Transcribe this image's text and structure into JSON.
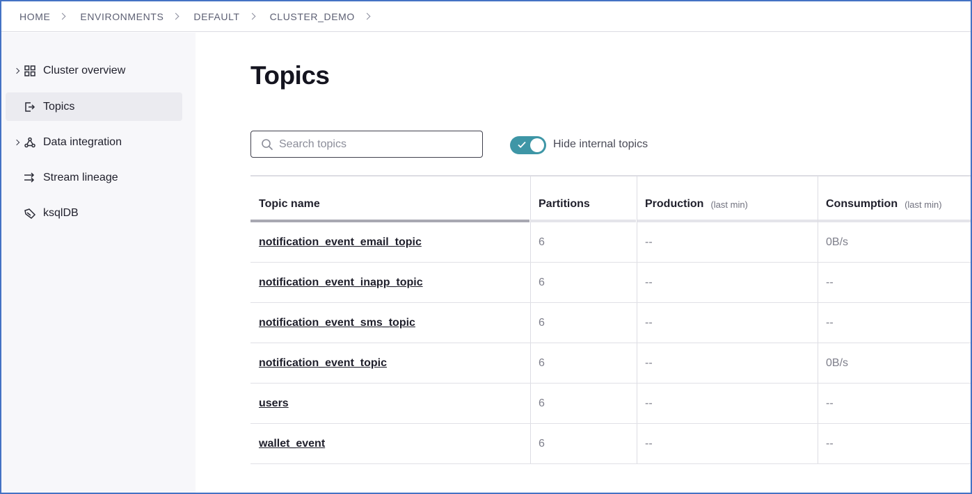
{
  "breadcrumb": [
    "HOME",
    "ENVIRONMENTS",
    "DEFAULT",
    "CLUSTER_DEMO"
  ],
  "sidebar": {
    "items": [
      {
        "label": "Cluster overview",
        "icon": "grid-icon",
        "expandable": true,
        "active": false
      },
      {
        "label": "Topics",
        "icon": "topics-icon",
        "expandable": false,
        "active": true
      },
      {
        "label": "Data integration",
        "icon": "integration-icon",
        "expandable": true,
        "active": false
      },
      {
        "label": "Stream lineage",
        "icon": "stream-lineage-icon",
        "expandable": false,
        "active": false
      },
      {
        "label": "ksqlDB",
        "icon": "ksqldb-icon",
        "expandable": false,
        "active": false
      }
    ]
  },
  "main": {
    "title": "Topics",
    "search": {
      "placeholder": "Search topics",
      "value": ""
    },
    "toggle": {
      "label": "Hide internal topics",
      "checked": true
    }
  },
  "table": {
    "columns": [
      {
        "title": "Topic name",
        "sub": ""
      },
      {
        "title": "Partitions",
        "sub": ""
      },
      {
        "title": "Production",
        "sub": "(last min)"
      },
      {
        "title": "Consumption",
        "sub": "(last min)"
      }
    ],
    "rows": [
      {
        "name": "notification_event_email_topic",
        "partitions": "6",
        "production": "--",
        "consumption": "0B/s"
      },
      {
        "name": "notification_event_inapp_topic",
        "partitions": "6",
        "production": "--",
        "consumption": "--"
      },
      {
        "name": "notification_event_sms_topic",
        "partitions": "6",
        "production": "--",
        "consumption": "--"
      },
      {
        "name": "notification_event_topic",
        "partitions": "6",
        "production": "--",
        "consumption": "0B/s"
      },
      {
        "name": "users",
        "partitions": "6",
        "production": "--",
        "consumption": "--"
      },
      {
        "name": "wallet_event",
        "partitions": "6",
        "production": "--",
        "consumption": "--"
      }
    ]
  },
  "colors": {
    "accent": "#3e96a6",
    "frame": "#4472c4",
    "sidebar_bg": "#f7f7fa"
  }
}
